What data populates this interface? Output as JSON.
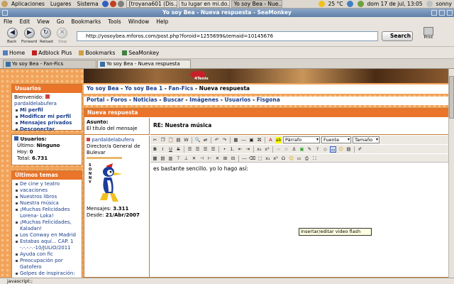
{
  "panel": {
    "apps": "Aplicaciones",
    "places": "Lugares",
    "system": "Sistema",
    "tasks": [
      "[troyana601 (Dis...",
      "tu lugar en mi.do...",
      "Yo soy Bea - Nue..."
    ],
    "weather": "25 °C",
    "datetime": "dom 17 de jul, 13:05",
    "user": "sonny"
  },
  "window_title": "Yo soy Bea - Nueva respuesta - SeaMonkey",
  "menubar": [
    "File",
    "Edit",
    "View",
    "Go",
    "Bookmarks",
    "Tools",
    "Window",
    "Help"
  ],
  "nav": {
    "back": "Back",
    "forward": "Forward",
    "reload": "Reload",
    "stop": "Stop",
    "url": "http://yosoybea.mforos.com/post.php?foroid=1255699&temaid=10145676",
    "search": "Search",
    "print": "Print"
  },
  "bookmarks": [
    "Home",
    "Adblock Plus",
    "Bookmarks",
    "SeaMonkey"
  ],
  "tabs": [
    "Yo soy Bea - Fan-Fics",
    "Yo soy Bea - Nueva respuesta"
  ],
  "banner_logo": "4Tenis",
  "breadcrumb": {
    "parts": [
      "Yo soy Bea",
      "Yo soy Bea 1",
      "Fan-Fics",
      "Nueva respuesta"
    ],
    "sep": " - "
  },
  "topmenu": [
    "Portal",
    "Foros",
    "Noticias",
    "Buscar",
    "Imágenes",
    "Usuarios",
    "Fisgona"
  ],
  "users_box": {
    "title": "Usuarios",
    "welcome": "Bienvenido:",
    "username": "pardaldelabufera",
    "links": [
      "Mi perfil",
      "Modificar mi perfil",
      "Mensajes privados",
      "Desconectar"
    ]
  },
  "stats_box": {
    "title": "Usuarios:",
    "ultimo_label": "Último:",
    "ultimo": "Ninguno",
    "hoy_label": "Hoy:",
    "hoy": "0",
    "total_label": "Total:",
    "total": "6.731"
  },
  "topics_box": {
    "title": "Últimos temas",
    "items": [
      "De cine y teatro",
      "vacaciones",
      "Nuestros libros",
      "Nuestra música",
      "¡Muchas Felicidades Lorena- Loka!",
      "¡Muchas Felicidades, Kaladan!",
      "Los Conway en Madrid",
      "Estabas aquí... CAP. 1 -.-.-.-.-10/JULIO/2011",
      "Ayuda con fic",
      "Preocupación por Gatofero",
      "Golpes de inspiración: 2.- El Fan"
    ]
  },
  "reply": {
    "header": "Nueva respuesta",
    "asunto_label": "Asunto:",
    "asunto_help": "El título del mensaje",
    "subject": "RE: Nuestra música",
    "author": "pardaldelabufera",
    "rank": "Director/a General de Bulevar",
    "avatar_text": "SONNY",
    "mensajes_label": "Mensajes:",
    "mensajes": "3.311",
    "desde_label": "Desde:",
    "desde": "21/Abr/2007",
    "body": "es bastante sencillo. yo lo hago así:"
  },
  "toolbar": {
    "format": "Párrafo",
    "font": "Fuente",
    "size": "Tamaño"
  },
  "tooltip": "Insertar/editar video flash",
  "status": "javascript:;"
}
